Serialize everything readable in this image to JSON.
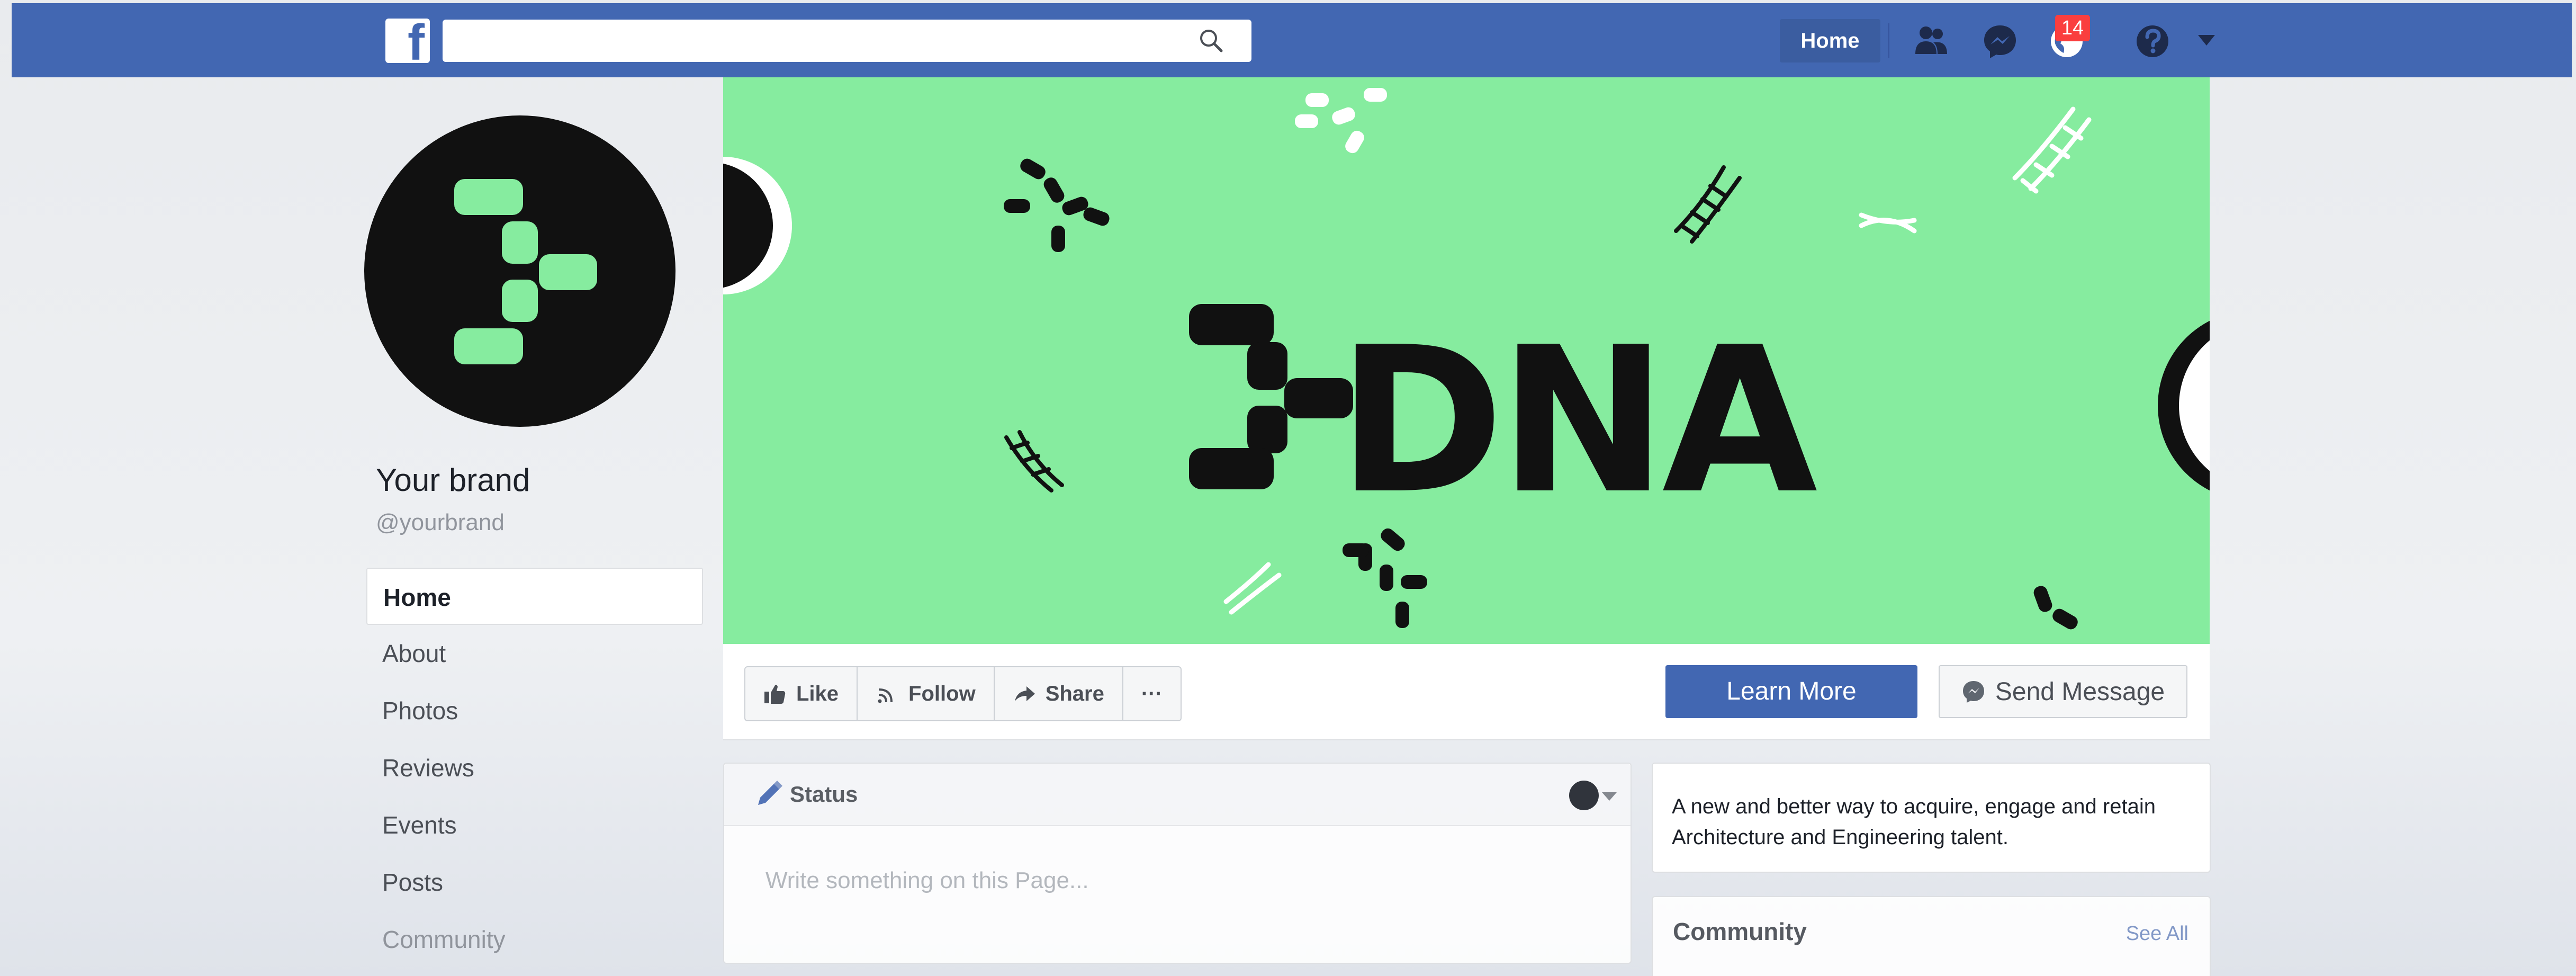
{
  "header": {
    "search_placeholder": "",
    "home_label": "Home",
    "notifications_count": "14",
    "icons": [
      "facebook-logo-icon",
      "search-icon",
      "friend-requests-icon",
      "messenger-icon",
      "notifications-globe-icon",
      "help-icon",
      "account-menu-caret-icon"
    ]
  },
  "colors": {
    "brand_blue": "#4267b2",
    "cover_green": "#86ec9f",
    "badge_red": "#fa3e3e"
  },
  "page": {
    "name": "Your brand",
    "handle": "@yourbrand",
    "cover_wordmark": "DNA"
  },
  "sidebar": {
    "items": [
      {
        "label": "Home"
      },
      {
        "label": "About"
      },
      {
        "label": "Photos"
      },
      {
        "label": "Reviews"
      },
      {
        "label": "Events"
      },
      {
        "label": "Posts"
      },
      {
        "label": "Community"
      }
    ]
  },
  "actions": {
    "like": "Like",
    "follow": "Follow",
    "share": "Share",
    "more": "···",
    "learn_more": "Learn More",
    "send_message": "Send Message"
  },
  "composer": {
    "tab_label": "Status",
    "placeholder": "Write something on this Page..."
  },
  "about": {
    "description": "A new and better way to acquire, engage and retain Architecture and Engineering talent."
  },
  "community": {
    "title": "Community",
    "see_all": "See All"
  }
}
